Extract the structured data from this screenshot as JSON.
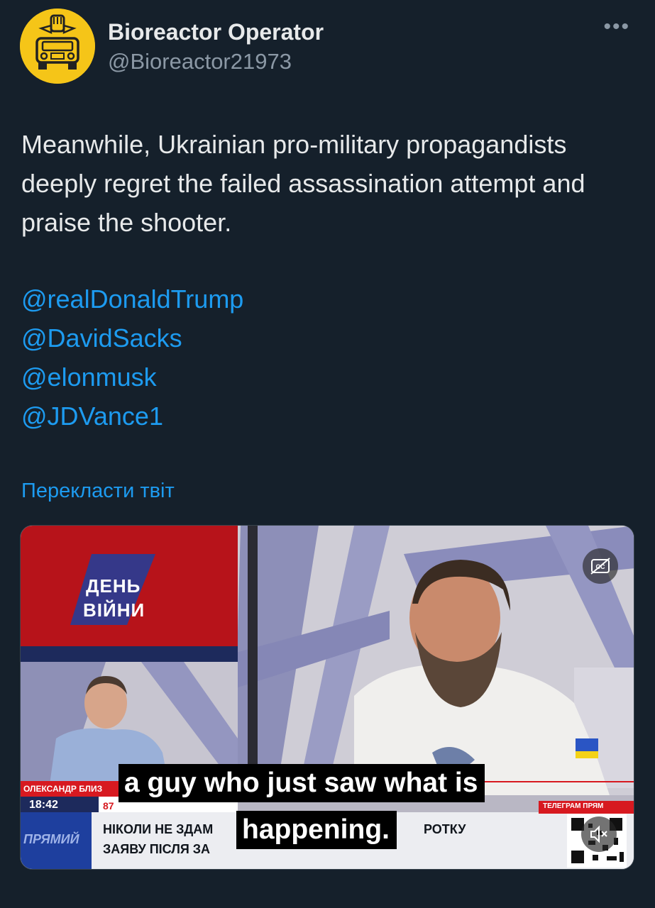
{
  "author": {
    "display_name": "Bioreactor Operator",
    "handle": "@Bioreactor21973",
    "avatar_icon": "avatar-car-fist-icon"
  },
  "menu": {
    "more_icon": "more-dots-icon"
  },
  "tweet": {
    "text": "Meanwhile, Ukrainian pro-military propagandists deeply regret the failed assassination attempt and praise the shooter.",
    "mentions": [
      "@realDonaldTrump",
      "@DavidSacks",
      "@elonmusk",
      "@JDVance1"
    ],
    "translate_label": "Перекласти твіт"
  },
  "video": {
    "subtitle_line1": "a guy who just saw what is",
    "subtitle_line2": "happening.",
    "show_logo_line1": "ДЕНЬ",
    "show_logo_line2": "ВІЙНИ",
    "name_strap": "ОЛЕКСАНДР БЛИЗ",
    "time": "18:42",
    "channel_number": "87",
    "live_label": "ПРЯМИЙ",
    "headline_line1": "НІКОЛИ НЕ ЗДАМ",
    "headline_line1_end": "РОТКУ",
    "headline_line2": "ЗАЯВУ ПІСЛЯ ЗА",
    "telegram_label": "ТЕЛЕГРАМ ПРЯМ",
    "captions_icon": "closed-captions-icon",
    "mute_icon": "mute-icon",
    "colors": {
      "accent_red": "#d71920",
      "caption_bg": "#000000"
    }
  },
  "colors": {
    "background": "#15202b",
    "link": "#1d9bf0",
    "secondary_text": "#8b98a5"
  }
}
